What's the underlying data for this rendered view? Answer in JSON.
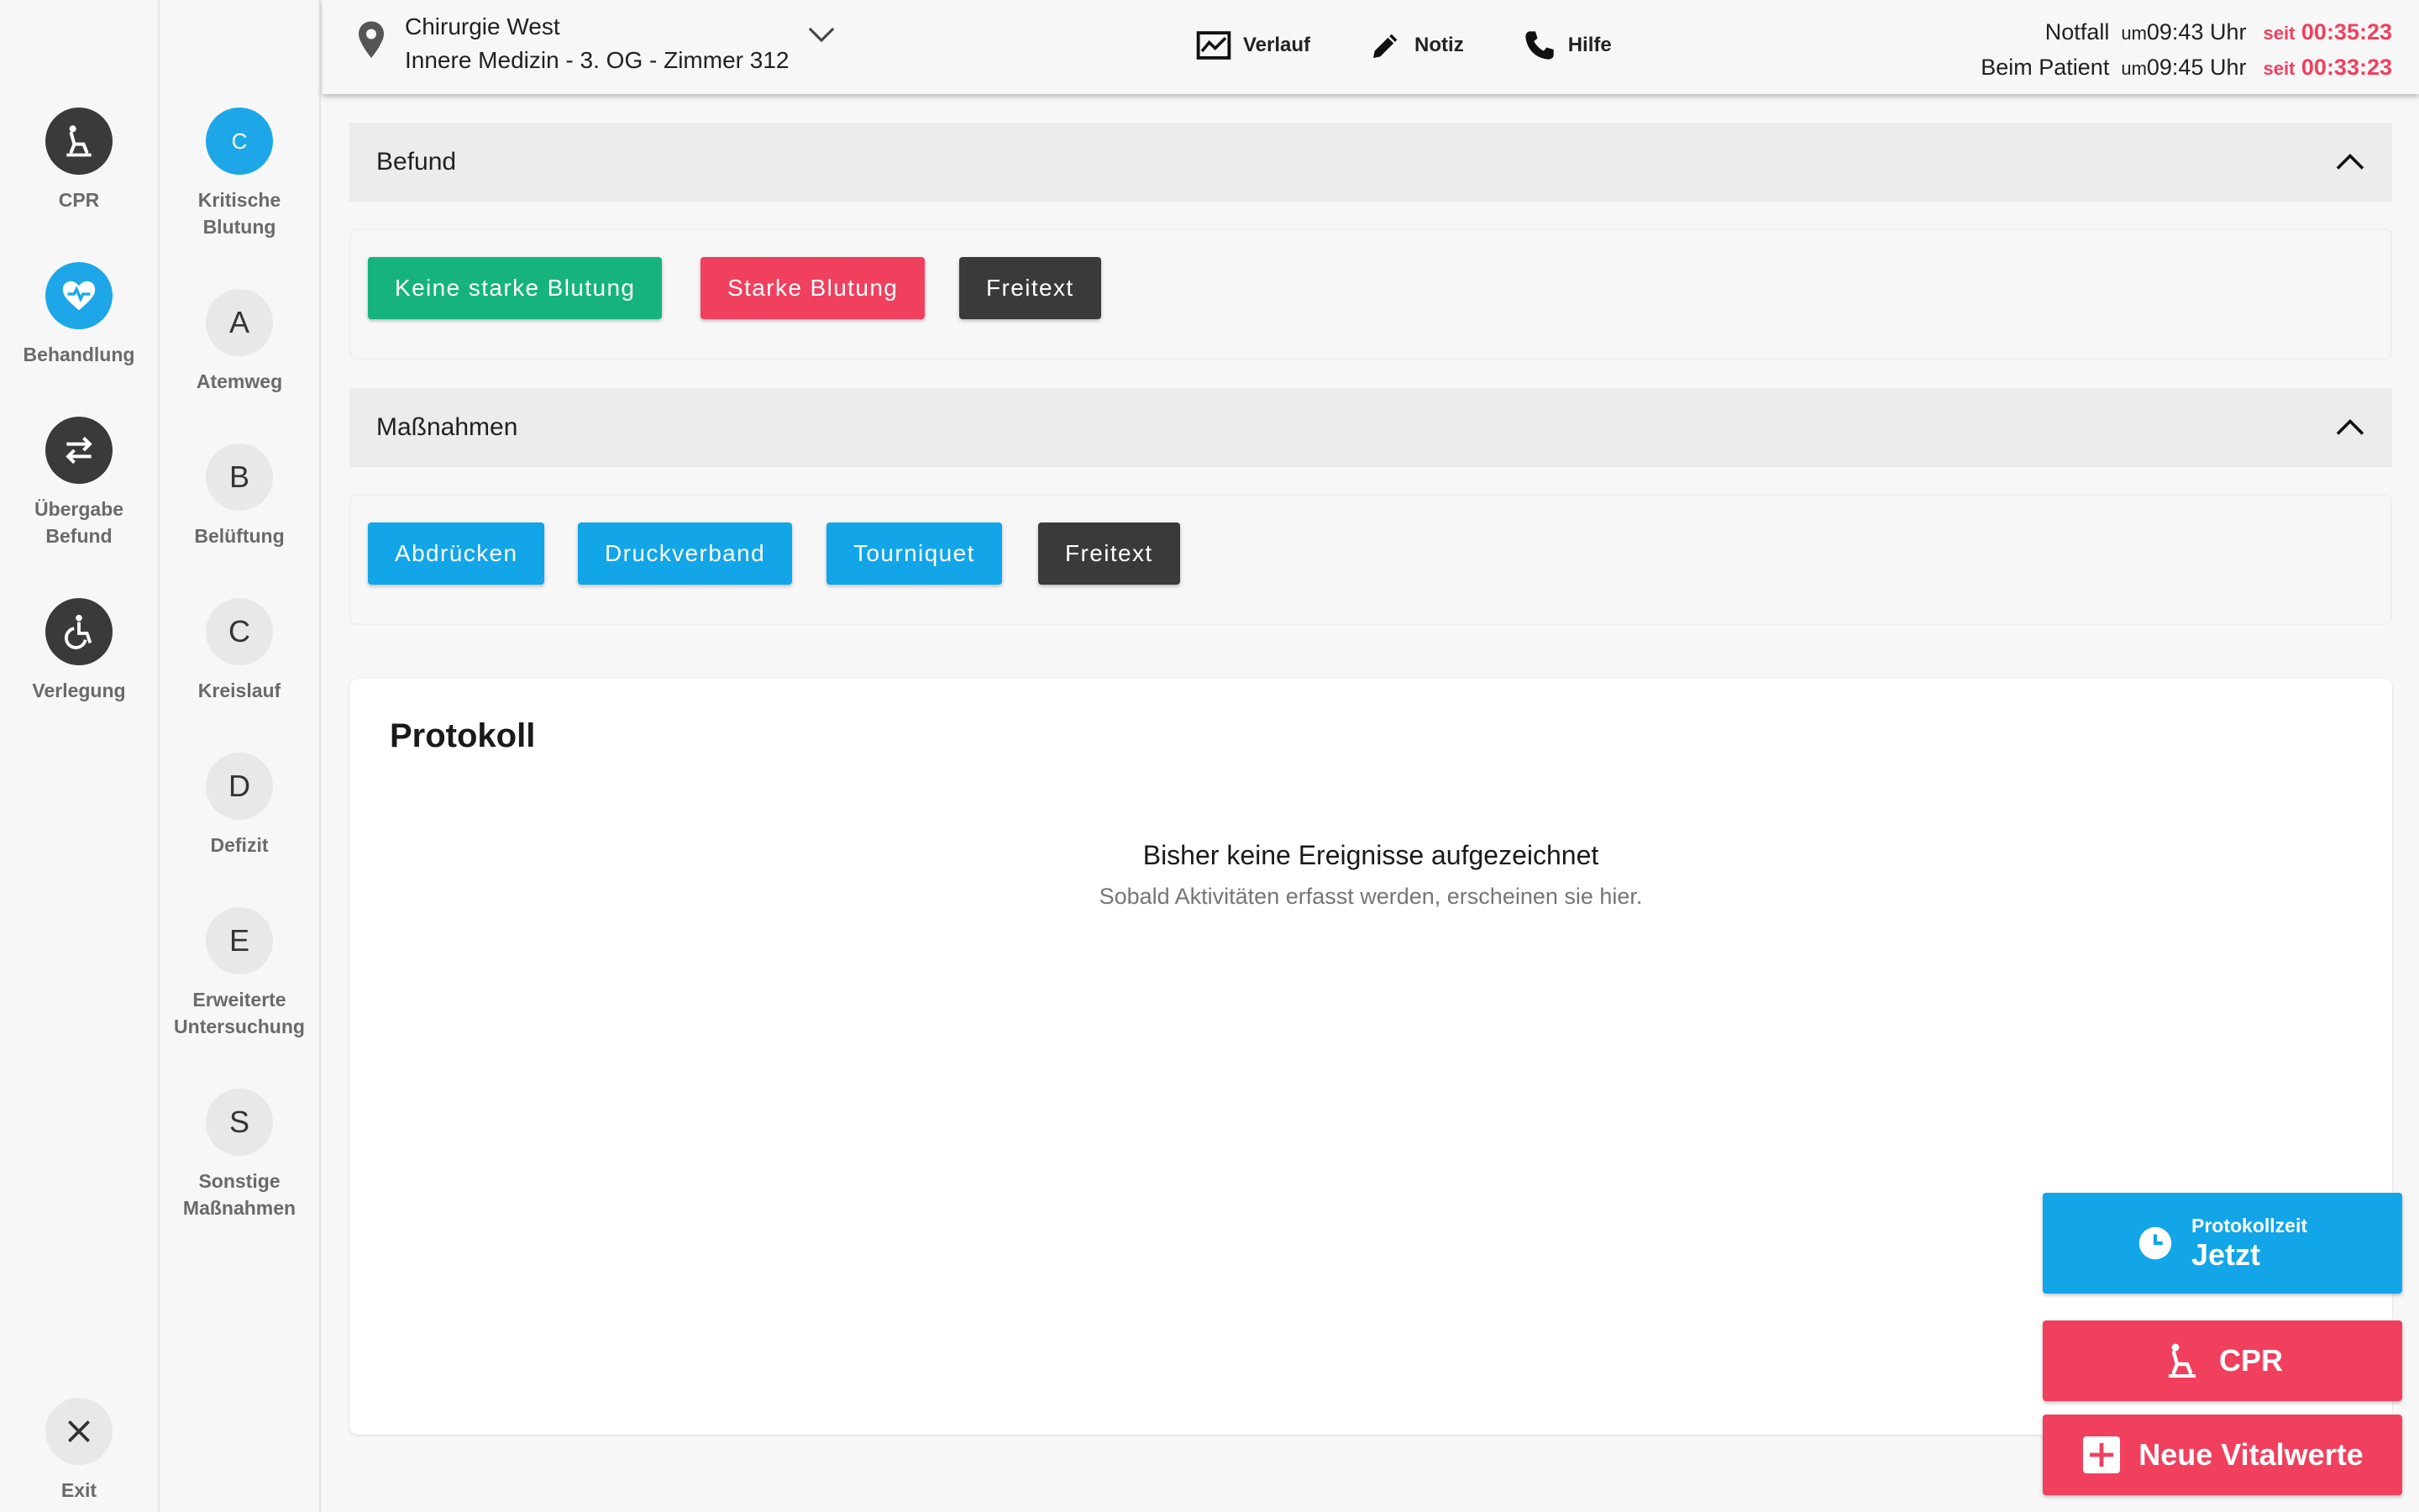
{
  "nav_primary": [
    {
      "label": "CPR",
      "icon": "cpr-icon"
    },
    {
      "label": "Behandlung",
      "icon": "heart-pulse-icon"
    },
    {
      "label": "Übergabe\nBefund",
      "icon": "swap-icon"
    },
    {
      "label": "Verlegung",
      "icon": "wheelchair-icon"
    }
  ],
  "nav_exit": {
    "label": "Exit",
    "icon": "close-icon"
  },
  "nav_abcde": [
    {
      "letter": "C",
      "label": "Kritische\nBlutung"
    },
    {
      "letter": "A",
      "label": "Atemweg"
    },
    {
      "letter": "B",
      "label": "Belüftung"
    },
    {
      "letter": "C",
      "label": "Kreislauf"
    },
    {
      "letter": "D",
      "label": "Defizit"
    },
    {
      "letter": "E",
      "label": "Erweiterte\nUntersuchung"
    },
    {
      "letter": "S",
      "label": "Sonstige\nMaßnahmen"
    }
  ],
  "header": {
    "location_line1": "Chirurgie West",
    "location_line2": "Innere Medizin - 3. OG - Zimmer 312",
    "tools": [
      {
        "label": "Verlauf",
        "icon": "chart-icon"
      },
      {
        "label": "Notiz",
        "icon": "pencil-icon"
      },
      {
        "label": "Hilfe",
        "icon": "phone-icon"
      }
    ],
    "times": [
      {
        "label": "Notfall",
        "um": "um",
        "time": "09:43 Uhr",
        "seit": "seit",
        "duration": "00:35:23"
      },
      {
        "label": "Beim Patient",
        "um": "um",
        "time": "09:45 Uhr",
        "seit": "seit",
        "duration": "00:33:23"
      }
    ]
  },
  "befund": {
    "title": "Befund",
    "buttons": [
      {
        "label": "Keine starke Blutung",
        "color": "#16b47c"
      },
      {
        "label": "Starke Blutung",
        "color": "#f0405e"
      },
      {
        "label": "Freitext",
        "color": "#3a3a3a"
      }
    ]
  },
  "massnahmen": {
    "title": "Maßnahmen",
    "buttons": [
      {
        "label": "Abdrücken",
        "color": "#12a5e8"
      },
      {
        "label": "Druckverband",
        "color": "#12a5e8"
      },
      {
        "label": "Tourniquet",
        "color": "#12a5e8"
      },
      {
        "label": "Freitext",
        "color": "#3a3a3a"
      }
    ]
  },
  "protokoll": {
    "title": "Protokoll",
    "empty_title": "Bisher keine Ereignisse aufgezeichnet",
    "empty_sub": "Sobald Aktivitäten erfasst werden, erscheinen sie hier."
  },
  "fabs": {
    "time_small": "Protokollzeit",
    "time_big": "Jetzt",
    "cpr": "CPR",
    "vital": "Neue Vitalwerte"
  }
}
